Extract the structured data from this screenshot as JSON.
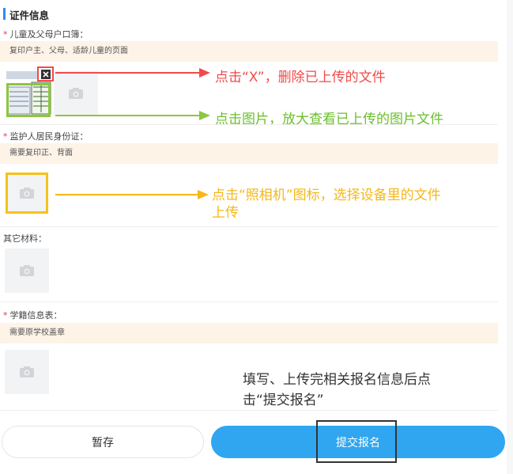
{
  "section": {
    "title": "证件信息"
  },
  "fields": {
    "household": {
      "required_mark": "*",
      "label": "儿童及父母户口簿：",
      "hint": "复印户主、父母、适龄儿童的页面"
    },
    "guardian_id": {
      "required_mark": "*",
      "label": "监护人居民身份证：",
      "hint": "需要复印正、背面"
    },
    "other": {
      "label": "其它材料："
    },
    "school_record": {
      "required_mark": "*",
      "label": "学籍信息表：",
      "hint": "需要原学校盖章"
    }
  },
  "annotations": {
    "delete_note": "点击“X”，删除已上传的文件",
    "preview_note": "点击图片，放大查看已上传的图片文件",
    "camera_note_line1": "点击“照相机”图标，选择设备里的文件",
    "camera_note_line2": "上传",
    "submit_note_line1": "填写、上传完相关报名信息后点",
    "submit_note_line2": "击“提交报名”"
  },
  "buttons": {
    "save": "暂存",
    "submit": "提交报名"
  },
  "colors": {
    "accent": "#2d8cf0",
    "submit_bg": "#2fa6ef",
    "hint_bg": "#fdf3e7",
    "required": "#e6364b",
    "annotation_red": "#f24a4a",
    "annotation_green": "#6bbf2c",
    "annotation_yellow": "#f5b71a"
  },
  "icons": [
    "camera-icon",
    "close-icon",
    "document-thumbnail"
  ]
}
